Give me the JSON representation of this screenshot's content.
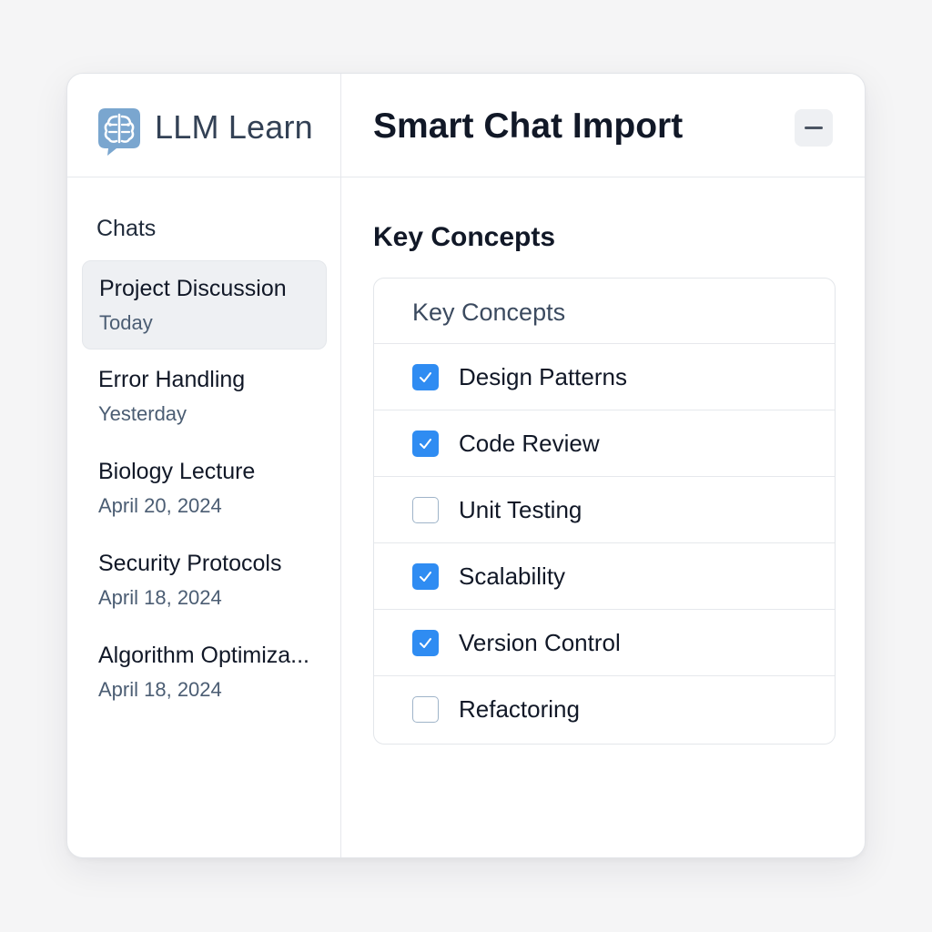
{
  "brand": {
    "name": "LLM Learn",
    "logo_icon": "brain-chat-bubble-icon",
    "logo_color": "#7aa6cf"
  },
  "sidebar": {
    "heading": "Chats",
    "items": [
      {
        "title": "Project Discussion",
        "date": "Today",
        "active": true
      },
      {
        "title": "Error Handling",
        "date": "Yesterday",
        "active": false
      },
      {
        "title": "Biology Lecture",
        "date": "April 20, 2024",
        "active": false
      },
      {
        "title": "Security Protocols",
        "date": "April 18, 2024",
        "active": false
      },
      {
        "title": "Algorithm Optimiza...",
        "date": "April 18, 2024",
        "active": false
      }
    ]
  },
  "main": {
    "title": "Smart Chat Import",
    "minimize_icon": "minus-icon",
    "section_title": "Key Concepts",
    "card": {
      "header": "Key Concepts",
      "concepts": [
        {
          "label": "Design Patterns",
          "checked": true
        },
        {
          "label": "Code Review",
          "checked": true
        },
        {
          "label": "Unit Testing",
          "checked": false
        },
        {
          "label": "Scalability",
          "checked": true
        },
        {
          "label": "Version Control",
          "checked": true
        },
        {
          "label": "Refactoring",
          "checked": false
        }
      ]
    }
  },
  "colors": {
    "accent": "#2f8cf2",
    "active_item_bg": "#eef0f3",
    "unchecked_border": "#9fb4c9"
  }
}
